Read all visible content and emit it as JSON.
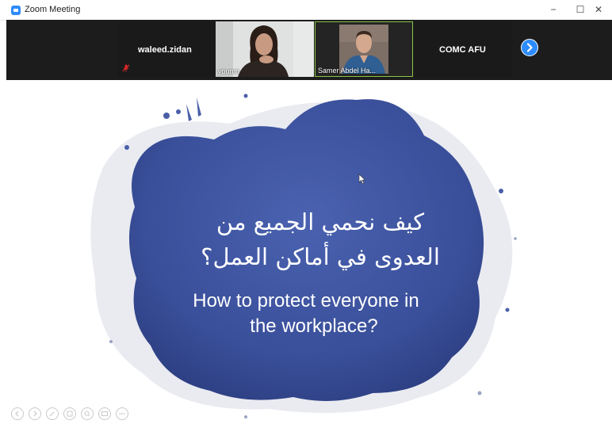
{
  "window": {
    "title": "Zoom Meeting",
    "controls": {
      "minimize": "−",
      "maximize": "☐",
      "close": "✕"
    }
  },
  "participants": [
    {
      "display_name": "waleed.zidan",
      "video": false,
      "muted": true
    },
    {
      "label": "youmn",
      "video": true
    },
    {
      "label": "Samer Abdel Ha...",
      "video": true,
      "active_speaker": true
    },
    {
      "display_name": "COMC AFU",
      "video": false
    }
  ],
  "participant_strip": {
    "next_icon": "chevron-right-icon"
  },
  "slide": {
    "arabic_line_1": "كيف نحمي الجميع من",
    "arabic_line_2": "العدوى في أماكن العمل؟",
    "english_line_1": "How to protect everyone in",
    "english_line_2": "the workplace?",
    "background_color": "#3a4f9a"
  },
  "colors": {
    "accent": "#2d8cff",
    "strip_bg": "#1c1c1c",
    "active_speaker_border": "#8bc34a",
    "muted_icon": "#e02828"
  }
}
